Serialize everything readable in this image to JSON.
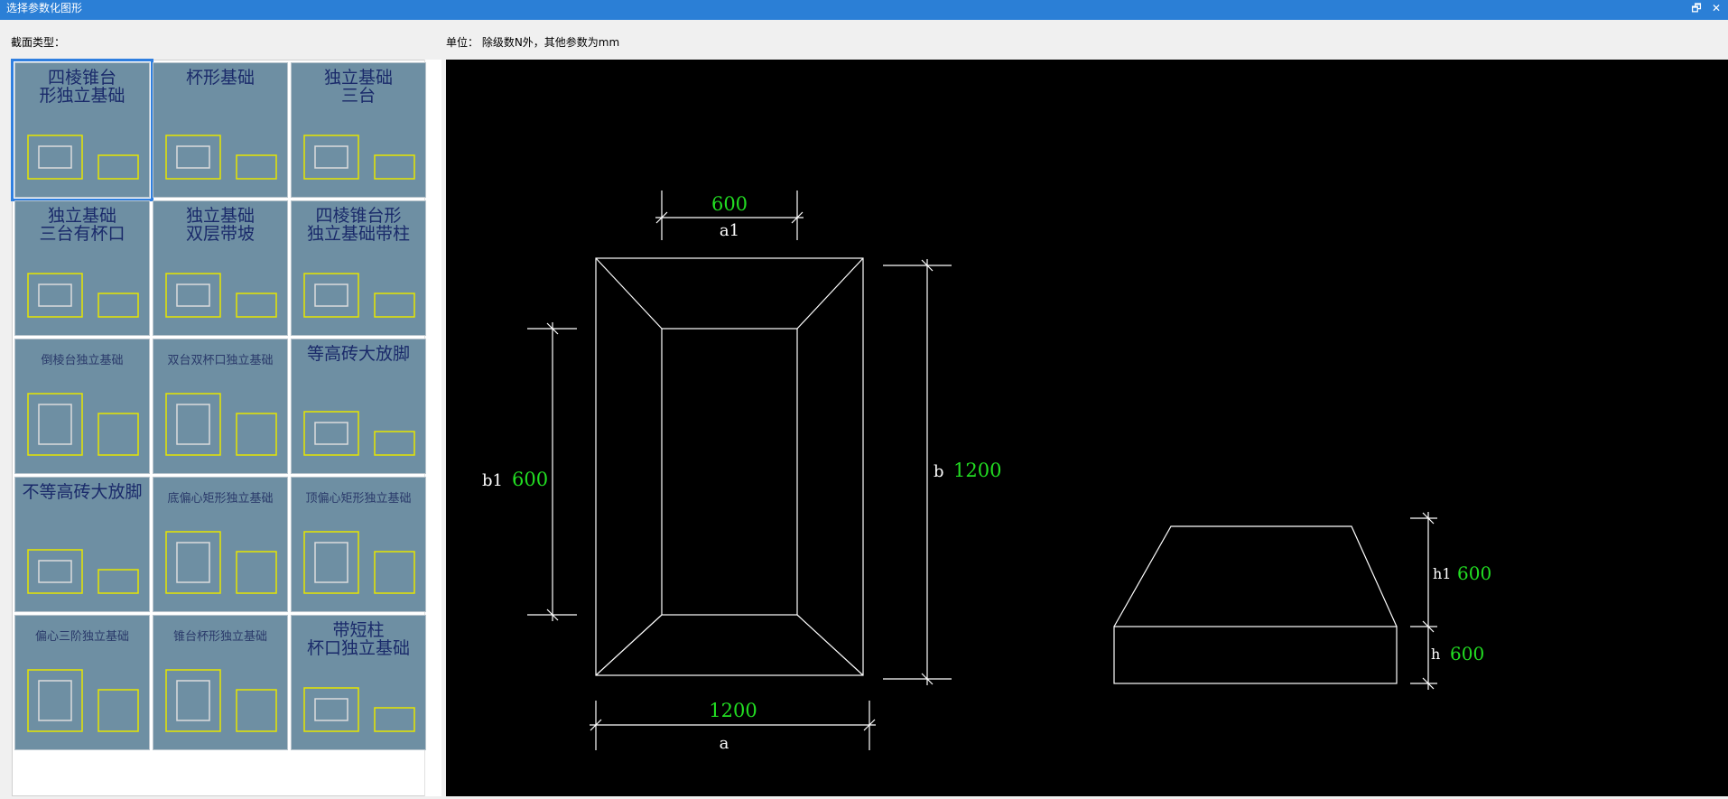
{
  "window": {
    "title": "选择参数化图形",
    "restore_glyph": "🗗",
    "close_glyph": "✕"
  },
  "labels": {
    "section_type": "截面类型：",
    "unit": "单位：  除级数N外，其他参数为mm"
  },
  "tiles": [
    {
      "title": "四棱锥台形独立基础",
      "lines": [
        "四棱锥台",
        "形独立基础"
      ],
      "selected": true
    },
    {
      "title": "杯形基础",
      "lines": [
        "杯形基础"
      ]
    },
    {
      "title": "独立基础三台",
      "lines": [
        "独立基础",
        "三台"
      ]
    },
    {
      "title": "独立基础三台有杯口",
      "lines": [
        "独立基础",
        "三台有杯口"
      ]
    },
    {
      "title": "独立基础双层带坡",
      "lines": [
        "独立基础",
        "双层带坡"
      ]
    },
    {
      "title": "四棱锥台形独立基础带柱",
      "lines": [
        "四棱锥台形",
        "独立基础带柱"
      ]
    },
    {
      "title": "倒棱台独立基础",
      "lines": [
        "倒棱台独立基础"
      ],
      "small": true
    },
    {
      "title": "双台双杯口独立基础",
      "lines": [
        "双台双杯口独立基础"
      ],
      "small": true
    },
    {
      "title": "等高砖大放脚",
      "lines": [
        "等高砖大放脚"
      ]
    },
    {
      "title": "不等高砖大放脚",
      "lines": [
        "不等高砖大放脚"
      ]
    },
    {
      "title": "底偏心矩形独立基础",
      "lines": [
        "底偏心矩形独立基础"
      ],
      "small": true
    },
    {
      "title": "顶偏心矩形独立基础",
      "lines": [
        "顶偏心矩形独立基础"
      ],
      "small": true
    },
    {
      "title": "偏心三阶独立基础",
      "lines": [
        "偏心三阶独立基础"
      ],
      "small": true
    },
    {
      "title": "锥台杯形独立基础",
      "lines": [
        "锥台杯形独立基础"
      ],
      "small": true
    },
    {
      "title": "带短柱杯口独立基础",
      "lines": [
        "带短柱",
        "杯口独立基础"
      ]
    }
  ],
  "drawing": {
    "param_labels": {
      "a1": "a1",
      "a": "a",
      "b1": "b1",
      "b": "b",
      "h1": "h1",
      "h": "h"
    },
    "param_values": {
      "a1": "600",
      "a": "1200",
      "b1": "600",
      "b": "1200",
      "h1": "600",
      "h": "600"
    },
    "colors": {
      "line": "#ffffff",
      "value": "#22dd22",
      "background": "#000000"
    }
  }
}
